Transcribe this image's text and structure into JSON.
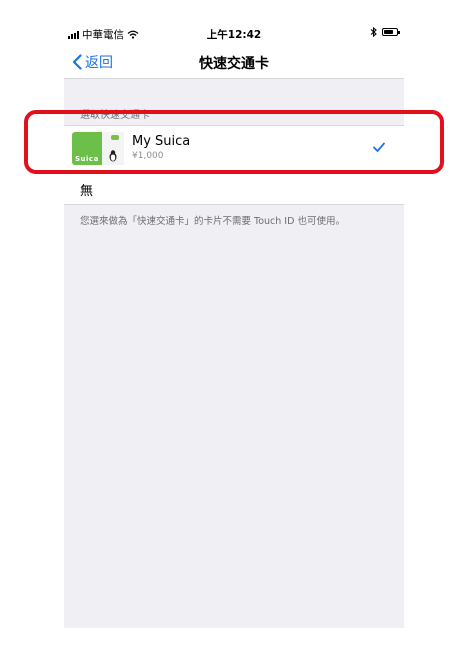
{
  "status_bar": {
    "carrier": "中華電信",
    "time": "上午12:42",
    "bluetooth": "bluetooth-icon",
    "battery": "battery-icon"
  },
  "nav": {
    "back_label": "返回",
    "title": "快速交通卡"
  },
  "section": {
    "header": "選取快速交通卡"
  },
  "card": {
    "name": "My Suica",
    "balance": "¥1,000",
    "logo_text": "Suica",
    "selected": true
  },
  "none_option": {
    "label": "無"
  },
  "footer": {
    "note": "您選來做為「快速交通卡」的卡片不需要 Touch ID 也可使用。"
  },
  "colors": {
    "accent": "#1a73e8",
    "highlight": "#e1101c",
    "card_green": "#6cc04a"
  }
}
